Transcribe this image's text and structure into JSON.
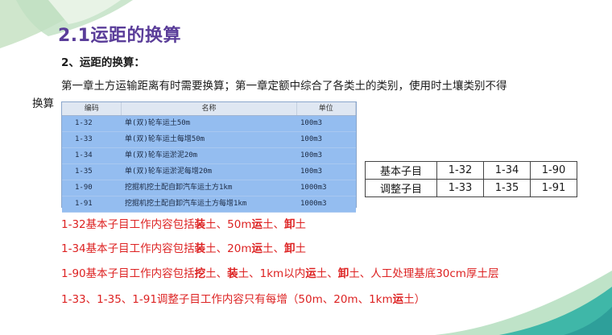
{
  "title": "2.1运距的换算",
  "subtitle": "2、运距的换算：",
  "paragraph_line1": "第一章土方运输距离有时需要换算；第一章定额中综合了各类土的类别，使用时土壤类别不得",
  "paragraph_line2": "换算",
  "code_table": {
    "headers": [
      "编码",
      "名称",
      "单位"
    ],
    "rows": [
      [
        "1-32",
        "单(双)轮车运土50m",
        "100m3"
      ],
      [
        "1-33",
        "单(双)轮车运土每增50m",
        "100m3"
      ],
      [
        "1-34",
        "单(双)轮车运淤泥20m",
        "100m3"
      ],
      [
        "1-35",
        "单(双)轮车运淤泥每增20m",
        "100m3"
      ],
      [
        "1-90",
        "挖掘机挖土配自卸汽车运土方1km",
        "1000m3"
      ],
      [
        "1-91",
        "挖掘机挖土配自卸汽车运土方每增1km",
        "1000m3"
      ]
    ]
  },
  "ref_table": {
    "rows": [
      [
        "基本子目",
        "1-32",
        "1-34",
        "1-90"
      ],
      [
        "调整子目",
        "1-33",
        "1-35",
        "1-91"
      ]
    ]
  },
  "notes": {
    "l1": {
      "a": "1-32基本子目工作内容包括",
      "b": "装",
      "c": "土、50m",
      "d": "运",
      "e": "土、",
      "f": "卸",
      "g": "土"
    },
    "l2": {
      "a": "1-34基本子目工作内容包括",
      "b": "装",
      "c": "土、20m",
      "d": "运",
      "e": "土、",
      "f": "卸",
      "g": "土"
    },
    "l3": {
      "a": "1-90基本子目工作内容包括",
      "b": "挖",
      "c": "土、",
      "d": "装",
      "e": "土、1km以内",
      "f": "运",
      "g": "土、",
      "h": "卸",
      "i": "土、人工处理基底30cm厚土层"
    },
    "l4": {
      "a": "1-33、1-35、1-91调整子目工作内容只有每增（50m、20m、1km",
      "b": "运",
      "c": "土）"
    }
  },
  "colors": {
    "title": "#5a3d99",
    "note_red": "#dd2222",
    "accent_teal": "#3fb7a8",
    "accent_green": "#b9dcb4"
  }
}
